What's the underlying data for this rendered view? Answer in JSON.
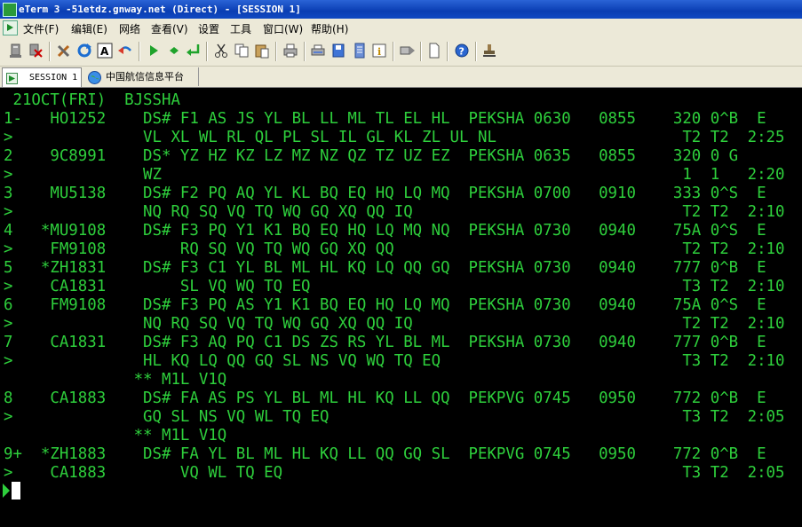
{
  "window": {
    "title": "eTerm 3 -51etdz.gnway.net (Direct) - [SESSION 1]"
  },
  "menu": {
    "items": [
      "文件(F)",
      "编辑(E)",
      "网络",
      "查看(V)",
      "设置",
      "工具",
      "窗口(W)",
      "帮助(H)"
    ]
  },
  "tabs": [
    {
      "label": "SESSION 1"
    },
    {
      "label": "中国航信信息平台"
    }
  ],
  "terminal": {
    "lines": [
      " 21OCT(FRI)  BJSSHA",
      "1-   HO1252    DS# F1 AS JS YL BL LL ML TL EL HL  PEKSHA 0630   0855    320 0^B  E",
      ">              VL XL WL RL QL PL SL IL GL KL ZL UL NL                    T2 T2  2:25",
      "2    9C8991    DS* YZ HZ KZ LZ MZ NZ QZ TZ UZ EZ  PEKSHA 0635   0855    320 0 G",
      ">              WZ                                                        1  1   2:20",
      "3    MU5138    DS# F2 PQ AQ YL KL BQ EQ HQ LQ MQ  PEKSHA 0700   0910    333 0^S  E",
      ">              NQ RQ SQ VQ TQ WQ GQ XQ QQ IQ                             T2 T2  2:10",
      "4   *MU9108    DS# F3 PQ Y1 K1 BQ EQ HQ LQ MQ NQ  PEKSHA 0730   0940    75A 0^S  E",
      ">    FM9108        RQ SQ VQ TQ WQ GQ XQ QQ                               T2 T2  2:10",
      "5   *ZH1831    DS# F3 C1 YL BL ML HL KQ LQ QQ GQ  PEKSHA 0730   0940    777 0^B  E",
      ">    CA1831        SL VQ WQ TQ EQ                                        T3 T2  2:10",
      "6    FM9108    DS# F3 PQ AS Y1 K1 BQ EQ HQ LQ MQ  PEKSHA 0730   0940    75A 0^S  E",
      ">              NQ RQ SQ VQ TQ WQ GQ XQ QQ IQ                             T2 T2  2:10",
      "7    CA1831    DS# F3 AQ PQ C1 DS ZS RS YL BL ML  PEKSHA 0730   0940    777 0^B  E",
      ">              HL KQ LQ QQ GQ SL NS VQ WQ TQ EQ                          T3 T2  2:10",
      "              ** M1L V1Q",
      "8    CA1883    DS# FA AS PS YL BL ML HL KQ LL QQ  PEKPVG 0745   0950    772 0^B  E",
      ">              GQ SL NS VQ WL TQ EQ                                      T3 T2  2:05",
      "              ** M1L V1Q",
      "9+  *ZH1883    DS# FA YL BL ML HL KQ LL QQ GQ SL  PEKPVG 0745   0950    772 0^B  E",
      ">    CA1883        VQ WL TQ EQ                                           T3 T2  2:05"
    ]
  },
  "toolbar": {
    "icons": [
      "connect-icon",
      "disconnect-icon",
      "tools-icon",
      "refresh-icon",
      "font-icon",
      "undo-icon",
      "run-icon",
      "step-icon",
      "return-icon",
      "cut-icon",
      "copy-icon",
      "paste-icon",
      "print-icon",
      "print-preview-icon",
      "save-icon",
      "notes-icon",
      "info-icon",
      "send-icon",
      "new-doc-icon",
      "help-icon",
      "stamp-icon"
    ]
  },
  "colors": {
    "terminal_fg": "#2ecf3c",
    "terminal_bg": "#000000",
    "titlebar": "#0a3eb3"
  }
}
